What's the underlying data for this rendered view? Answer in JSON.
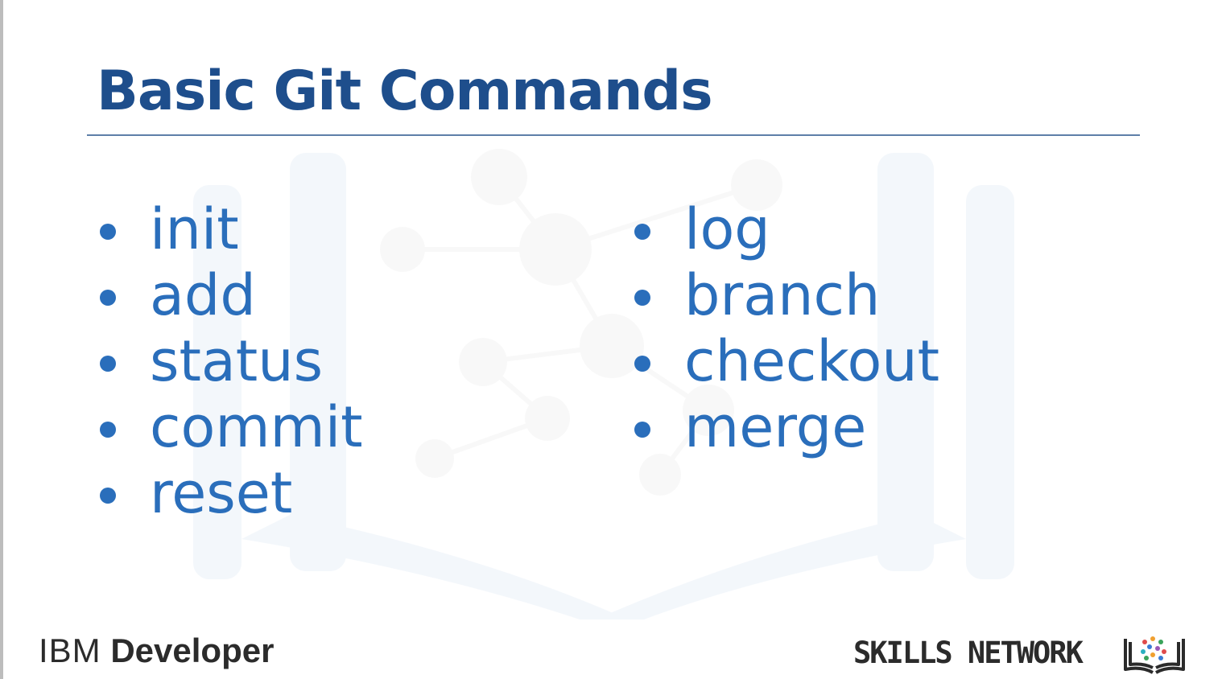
{
  "slide": {
    "title": "Basic Git Commands",
    "left_items": [
      "init",
      "add",
      "status",
      "commit",
      "reset"
    ],
    "right_items": [
      "log",
      "branch",
      "checkout",
      "merge"
    ]
  },
  "footer": {
    "ibm": "IBM",
    "developer": "Developer",
    "skills_network": "SKILLS NETWORK"
  },
  "colors": {
    "title": "#1e4e8c",
    "bullet_text": "#2a6ebb",
    "rule": "#5e7fa8",
    "footer_text": "#2b2b2b"
  },
  "icons": {
    "watermark": "open-book-network-icon",
    "skills_logo": "book-network-logo-icon"
  }
}
